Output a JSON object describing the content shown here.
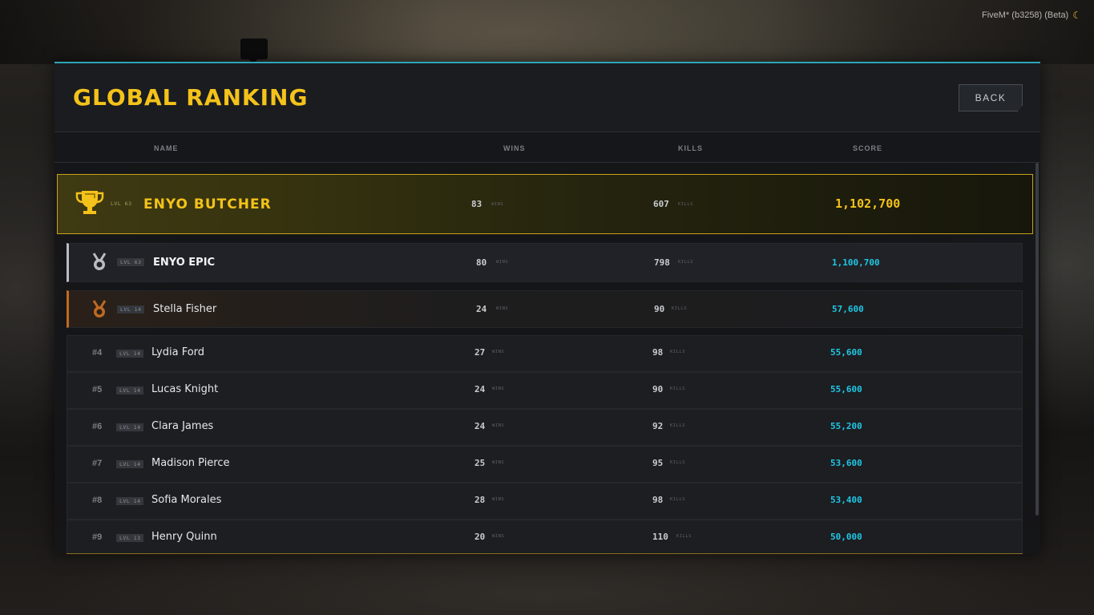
{
  "overlay": {
    "build_label": "FiveM* (b3258) (Beta)"
  },
  "header": {
    "title": "GLOBAL RANKING",
    "back_label": "BACK"
  },
  "columns": {
    "name": "NAME",
    "wins": "WINS",
    "kills": "KILLS",
    "score": "SCORE"
  },
  "units": {
    "wins": "WINS",
    "kills": "KILLS"
  },
  "colors": {
    "accent": "#f4c21a",
    "score": "#1fc7e4",
    "silver": "#b9bcc0",
    "bronze": "#c06a22",
    "frame": "#2ea5b8"
  },
  "leader": {
    "level": "LVL 63",
    "name": "ENYO BUTCHER",
    "wins": "83",
    "kills": "607",
    "score": "1,102,700",
    "icon": "trophy-icon"
  },
  "players": [
    {
      "rank": "",
      "level": "LVL 63",
      "name": "ENYO EPIC",
      "wins": "80",
      "kills": "798",
      "score": "1,100,700",
      "icon": "silver-medal-icon"
    },
    {
      "rank": "",
      "level": "LVL 14",
      "name": "Stella Fisher",
      "wins": "24",
      "kills": "90",
      "score": "57,600",
      "icon": "bronze-medal-icon"
    },
    {
      "rank": "#4",
      "level": "LVL 14",
      "name": "Lydia Ford",
      "wins": "27",
      "kills": "98",
      "score": "55,600"
    },
    {
      "rank": "#5",
      "level": "LVL 14",
      "name": "Lucas Knight",
      "wins": "24",
      "kills": "90",
      "score": "55,600"
    },
    {
      "rank": "#6",
      "level": "LVL 14",
      "name": "Clara James",
      "wins": "24",
      "kills": "92",
      "score": "55,200"
    },
    {
      "rank": "#7",
      "level": "LVL 14",
      "name": "Madison Pierce",
      "wins": "25",
      "kills": "95",
      "score": "53,600"
    },
    {
      "rank": "#8",
      "level": "LVL 14",
      "name": "Sofia Morales",
      "wins": "28",
      "kills": "98",
      "score": "53,400"
    },
    {
      "rank": "#9",
      "level": "LVL 13",
      "name": "Henry Quinn",
      "wins": "20",
      "kills": "110",
      "score": "50,000"
    }
  ]
}
